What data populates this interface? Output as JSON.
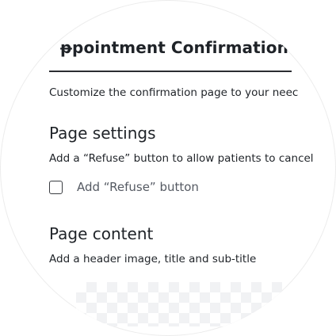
{
  "header": {
    "title": "ᵽpointment Confirmation›"
  },
  "description": "Customize the confirmation page to your neec",
  "page_settings": {
    "heading": "Page settings",
    "subtitle": "Add a “Refuse” button to allow patients to cancel",
    "refuse_checkbox": {
      "label": "Add “Refuse” button",
      "checked": false
    }
  },
  "page_content": {
    "heading": "Page content",
    "subtitle": "Add a header image, title and sub-title"
  },
  "colors": {
    "text": "#1f2328",
    "muted_label": "#555a63",
    "divider": "#2b2d31",
    "placeholder_checker": "#f0f1f3"
  }
}
